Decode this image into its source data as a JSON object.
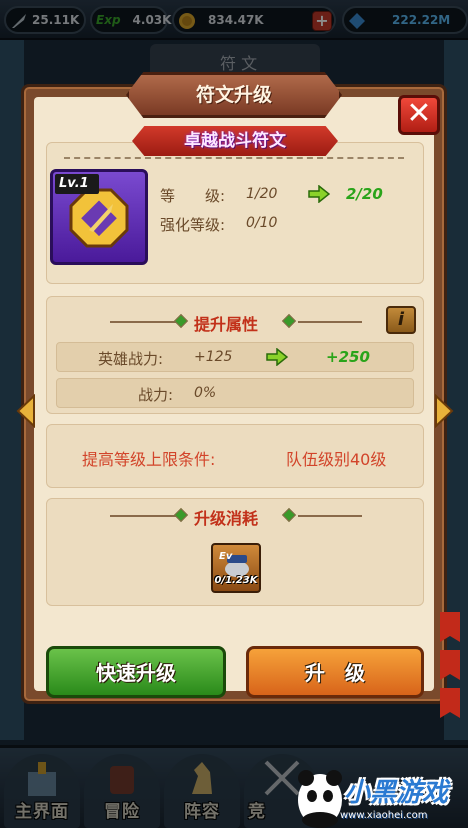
{
  "topbar": {
    "power": "25.11K",
    "exp_label": "Exp",
    "exp": "4.03K",
    "gold": "834.47K",
    "gems": "222.22M"
  },
  "background": {
    "tab_hint": "符 文"
  },
  "dialog": {
    "title": "符文升级",
    "close_symbol": "✕",
    "rune_name": "卓越战斗符文",
    "rune_level_badge": "Lv.1",
    "level_label": "等　　级:",
    "level_current": "1/20",
    "level_next": "2/20",
    "enhance_label": "强化等级:",
    "enhance_value": "0/10",
    "attr_section_title": "提升属性",
    "info_symbol": "i",
    "hero_power_label": "英雄战力:",
    "hero_power_current": "+125",
    "hero_power_next": "+250",
    "power_label": "战力:",
    "power_value": "0%",
    "condition_label": "提高等级上限条件:",
    "condition_value": "队伍级别40级",
    "cost_section_title": "升级消耗",
    "cost_badge": "Ev",
    "cost_value": "0/1.23K",
    "quick_upgrade_label": "快速升级",
    "upgrade_label": "升　级"
  },
  "bottom_nav": {
    "items": [
      "主界面",
      "冒险",
      "阵容",
      "竞"
    ]
  },
  "watermark": {
    "brand": "小黑游戏",
    "url": "www.xiaohei.com"
  },
  "colors": {
    "dialog_bg": "#f3e7cf",
    "frame": "#7a4a2c",
    "accent_red": "#c2311a",
    "green_value": "#2aa41a",
    "quick_button": "#4aa42a",
    "upgrade_button": "#e8842a"
  }
}
